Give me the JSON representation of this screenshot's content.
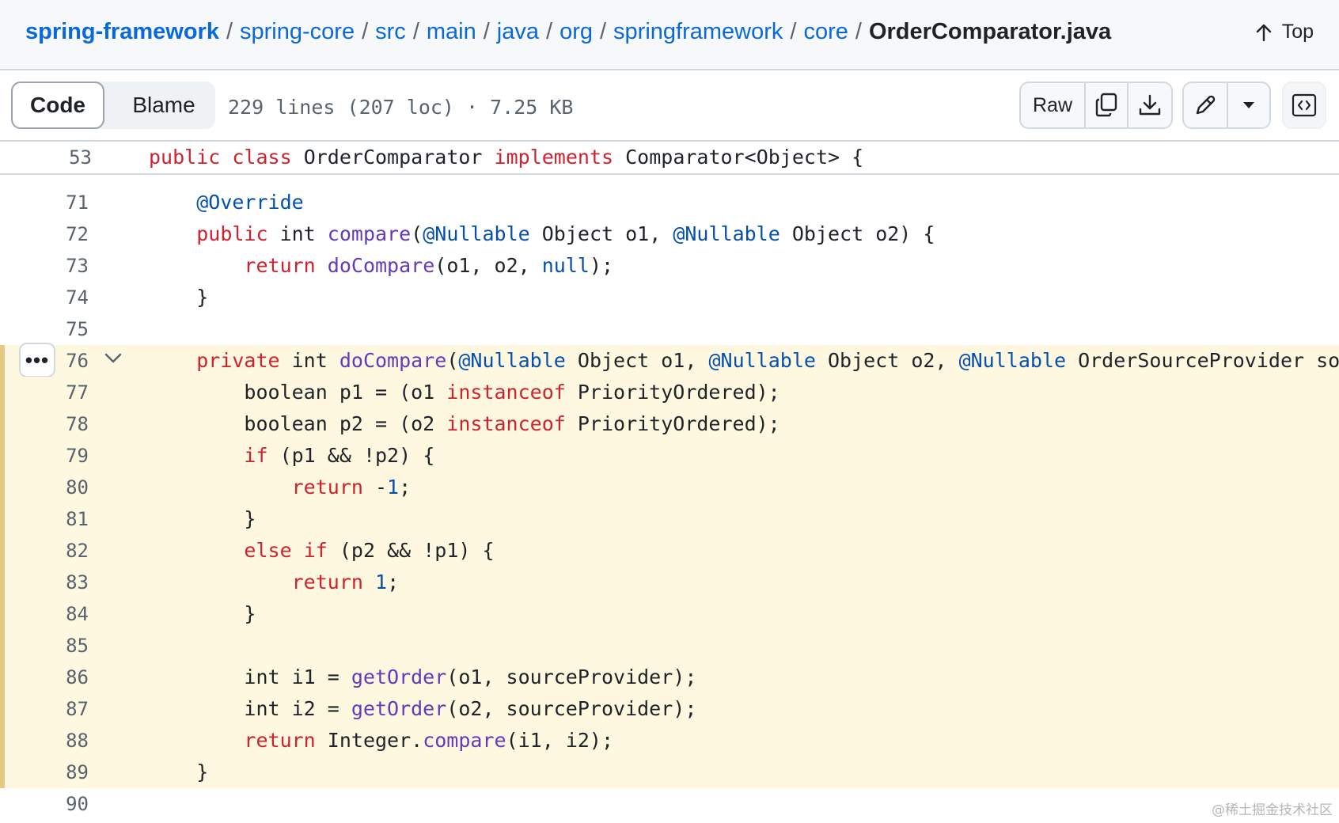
{
  "breadcrumb": {
    "segments": [
      "spring-framework",
      "spring-core",
      "src",
      "main",
      "java",
      "org",
      "springframework",
      "core"
    ],
    "separator": "/",
    "current": "OrderComparator.java"
  },
  "top_link": {
    "label": "Top"
  },
  "toolbar": {
    "code_tab": "Code",
    "blame_tab": "Blame",
    "file_info": "229 lines (207 loc) · 7.25 KB",
    "raw_label": "Raw"
  },
  "sticky_line": {
    "number": "53",
    "text": "public class OrderComparator implements Comparator<Object> {"
  },
  "watermark": "@稀土掘金技术社区",
  "colors": {
    "link": "#0969da",
    "keyword": "#cf222e",
    "function": "#6639ba",
    "annotation": "#0550ae",
    "highlight_bg": "#fff8e0",
    "highlight_bar": "#e3c983"
  },
  "code_lines": [
    {
      "n": "71",
      "hl": false,
      "tokens": [
        [
          "    ",
          ""
        ],
        [
          "@Override",
          "an"
        ]
      ]
    },
    {
      "n": "72",
      "hl": false,
      "tokens": [
        [
          "    ",
          ""
        ],
        [
          "public",
          "kw"
        ],
        [
          " int ",
          ""
        ],
        [
          "compare",
          "fn"
        ],
        [
          "(",
          ""
        ],
        [
          "@Nullable",
          "an"
        ],
        [
          " Object o1, ",
          ""
        ],
        [
          "@Nullable",
          "an"
        ],
        [
          " Object o2) {",
          ""
        ]
      ]
    },
    {
      "n": "73",
      "hl": false,
      "tokens": [
        [
          "        ",
          ""
        ],
        [
          "return",
          "kw"
        ],
        [
          " ",
          ""
        ],
        [
          "doCompare",
          "fn"
        ],
        [
          "(o1, o2, ",
          ""
        ],
        [
          "null",
          "nb"
        ],
        [
          ");",
          ""
        ]
      ]
    },
    {
      "n": "74",
      "hl": false,
      "tokens": [
        [
          "    }",
          ""
        ]
      ]
    },
    {
      "n": "75",
      "hl": false,
      "tokens": [
        [
          "",
          ""
        ]
      ]
    },
    {
      "n": "76",
      "hl": true,
      "tokens": [
        [
          "    ",
          ""
        ],
        [
          "private",
          "kw"
        ],
        [
          " int ",
          ""
        ],
        [
          "doCompare",
          "fn"
        ],
        [
          "(",
          ""
        ],
        [
          "@Nullable",
          "an"
        ],
        [
          " Object o1, ",
          ""
        ],
        [
          "@Nullable",
          "an"
        ],
        [
          " Object o2, ",
          ""
        ],
        [
          "@Nullable",
          "an"
        ],
        [
          " OrderSourceProvider sourceP",
          ""
        ]
      ]
    },
    {
      "n": "77",
      "hl": true,
      "tokens": [
        [
          "        boolean p1 = (o1 ",
          ""
        ],
        [
          "instanceof",
          "kw"
        ],
        [
          " PriorityOrdered);",
          ""
        ]
      ]
    },
    {
      "n": "78",
      "hl": true,
      "tokens": [
        [
          "        boolean p2 = (o2 ",
          ""
        ],
        [
          "instanceof",
          "kw"
        ],
        [
          " PriorityOrdered);",
          ""
        ]
      ]
    },
    {
      "n": "79",
      "hl": true,
      "tokens": [
        [
          "        ",
          ""
        ],
        [
          "if",
          "kw"
        ],
        [
          " (p1 && !p2) {",
          ""
        ]
      ]
    },
    {
      "n": "80",
      "hl": true,
      "tokens": [
        [
          "            ",
          ""
        ],
        [
          "return",
          "kw"
        ],
        [
          " -",
          ""
        ],
        [
          "1",
          "nb"
        ],
        [
          ";",
          ""
        ]
      ]
    },
    {
      "n": "81",
      "hl": true,
      "tokens": [
        [
          "        }",
          ""
        ]
      ]
    },
    {
      "n": "82",
      "hl": true,
      "tokens": [
        [
          "        ",
          ""
        ],
        [
          "else",
          "kw"
        ],
        [
          " ",
          ""
        ],
        [
          "if",
          "kw"
        ],
        [
          " (p2 && !p1) {",
          ""
        ]
      ]
    },
    {
      "n": "83",
      "hl": true,
      "tokens": [
        [
          "            ",
          ""
        ],
        [
          "return",
          "kw"
        ],
        [
          " ",
          ""
        ],
        [
          "1",
          "nb"
        ],
        [
          ";",
          ""
        ]
      ]
    },
    {
      "n": "84",
      "hl": true,
      "tokens": [
        [
          "        }",
          ""
        ]
      ]
    },
    {
      "n": "85",
      "hl": true,
      "tokens": [
        [
          "",
          ""
        ]
      ]
    },
    {
      "n": "86",
      "hl": true,
      "tokens": [
        [
          "        int i1 = ",
          ""
        ],
        [
          "getOrder",
          "fn"
        ],
        [
          "(o1, sourceProvider);",
          ""
        ]
      ]
    },
    {
      "n": "87",
      "hl": true,
      "tokens": [
        [
          "        int i2 = ",
          ""
        ],
        [
          "getOrder",
          "fn"
        ],
        [
          "(o2, sourceProvider);",
          ""
        ]
      ]
    },
    {
      "n": "88",
      "hl": true,
      "tokens": [
        [
          "        ",
          ""
        ],
        [
          "return",
          "kw"
        ],
        [
          " Integer.",
          ""
        ],
        [
          "compare",
          "fn"
        ],
        [
          "(i1, i2);",
          ""
        ]
      ]
    },
    {
      "n": "89",
      "hl": true,
      "tokens": [
        [
          "    }",
          ""
        ]
      ]
    },
    {
      "n": "90",
      "hl": false,
      "tokens": [
        [
          "",
          ""
        ]
      ]
    }
  ]
}
